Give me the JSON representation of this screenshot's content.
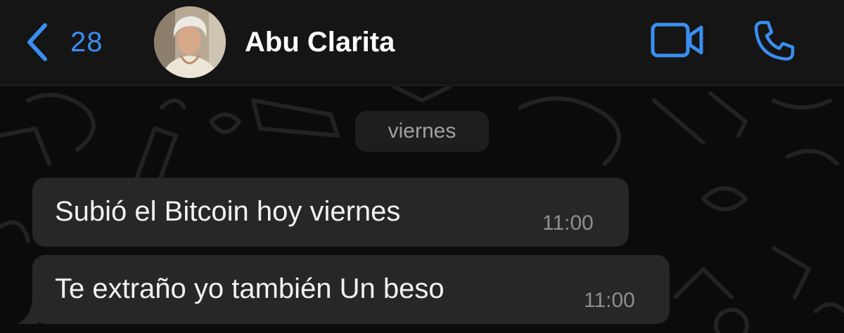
{
  "header": {
    "back_count": "28",
    "contact_name": "Abu Clarita"
  },
  "chat": {
    "date_label": "viernes",
    "messages": [
      {
        "text": "Subió el Bitcoin hoy viernes",
        "time": "11:00"
      },
      {
        "text": "Te extraño yo también Un beso",
        "time": "11:00"
      }
    ]
  },
  "colors": {
    "accent": "#3a8ef0",
    "header_bg": "#151515",
    "chat_bg": "#0b0b0b",
    "bubble_bg": "#272727",
    "date_pill_bg": "#1e1e1e"
  },
  "icons": [
    "back-chevron-icon",
    "video-call-icon",
    "phone-icon"
  ]
}
